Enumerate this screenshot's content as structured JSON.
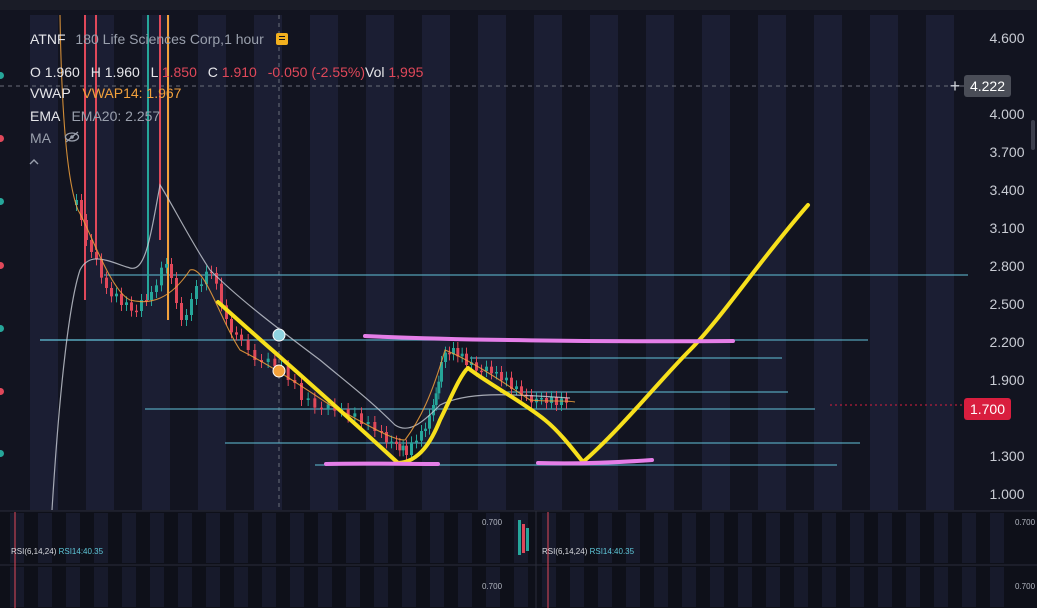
{
  "symbol": {
    "ticker": "ATNF",
    "name": "180 Life Sciences Corp",
    "interval": "1 hour"
  },
  "ohlc": {
    "o_label": "O",
    "o": "1.960",
    "h_label": "H",
    "h": "1.960",
    "l_label": "L",
    "l": "1.850",
    "c_label": "C",
    "c": "1.910",
    "chg": "-0.050",
    "chg_pct": "(-2.55%)",
    "vol_label": "Vol",
    "vol": "1,995"
  },
  "indicators": [
    {
      "name": "VWAP",
      "value_label": "VWAP14: 1.967"
    },
    {
      "name": "EMA",
      "value_label": "EMA20: 2.257"
    },
    {
      "name": "MA"
    }
  ],
  "price_axis": {
    "labels": [
      "4.600",
      "4.222",
      "4.000",
      "3.700",
      "3.400",
      "3.100",
      "2.800",
      "2.500",
      "2.200",
      "1.900",
      "1.700",
      "1.300",
      "1.000"
    ],
    "crosshair_price": "4.222",
    "last_price": "1.700"
  },
  "sub_panes": [
    {
      "rsi_label": "RSI(6,14,24)",
      "rsi_value": "RSI14:40.35",
      "axis_value": "0.700"
    },
    {
      "rsi_label": "RSI(6,14,24)",
      "rsi_value": "RSI14:40.35",
      "axis_value": "0.700"
    }
  ],
  "colors": {
    "background": "#121420",
    "band": "#1b1e33",
    "grid_line": "#5fb9cf",
    "candle_up": "#26a69a",
    "candle_down": "#e0485a",
    "drawing_yellow": "#f7e01c",
    "drawing_pink": "#e57ee8",
    "vwap": "#f2a13c",
    "ema": "#c9cdd6",
    "last_price": "#d91e3e"
  },
  "icons": [
    "flag-icon",
    "eye-slash-icon",
    "plus-icon",
    "chevron-up-icon"
  ]
}
